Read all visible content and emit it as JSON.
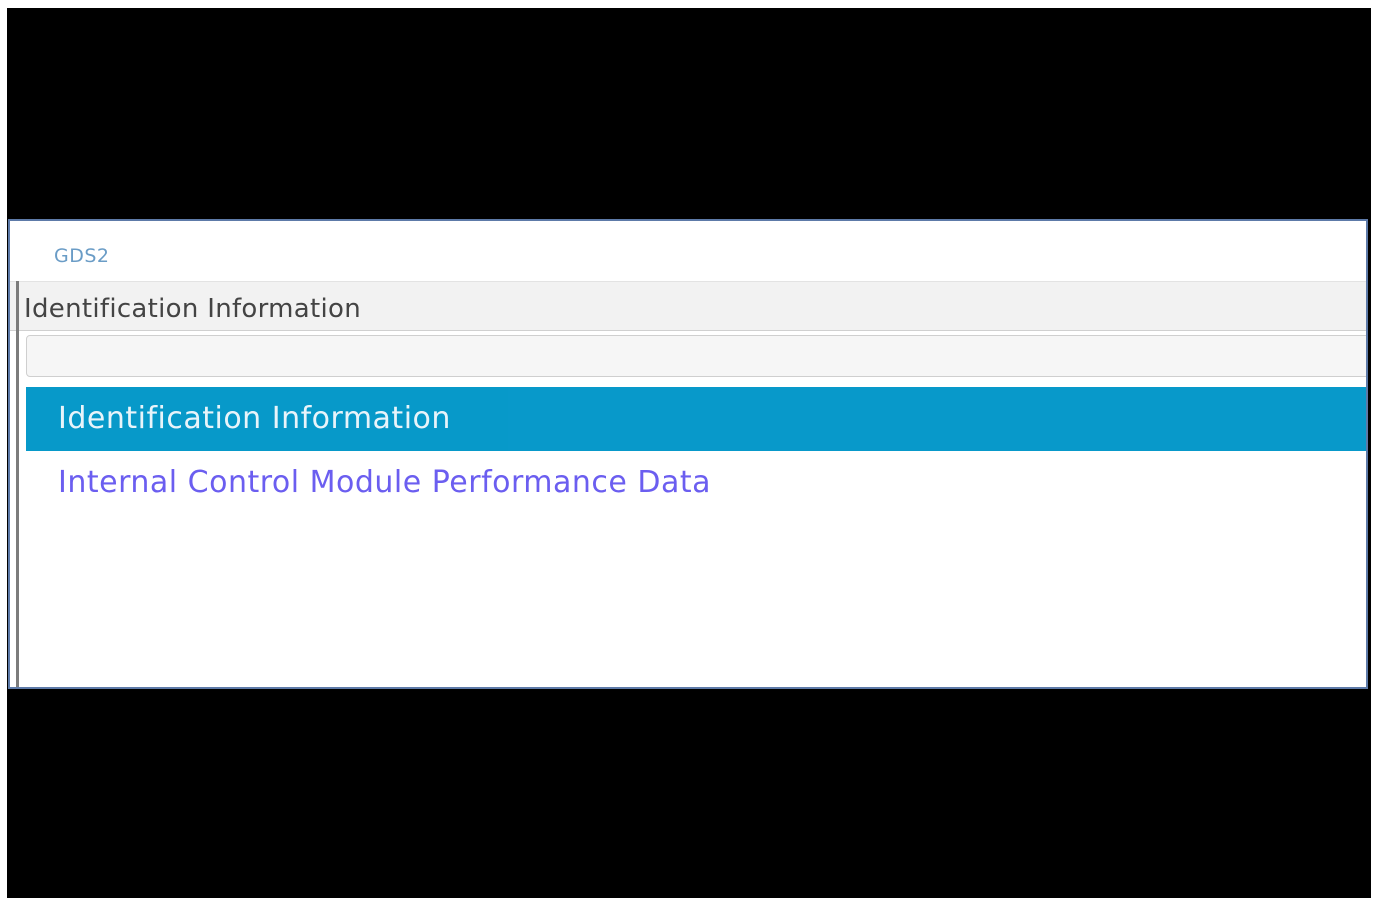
{
  "app": {
    "title": "GDS2"
  },
  "header": {
    "title": "Identification Information"
  },
  "filter": {
    "value": "",
    "placeholder": ""
  },
  "list": {
    "items": [
      {
        "label": "Identification Information",
        "selected": true
      },
      {
        "label": "Internal Control Module Performance Data",
        "selected": false
      }
    ]
  },
  "colors": {
    "selection": "#0096c8",
    "link_text": "#6b5ef0",
    "title_text": "#6a9cc6"
  }
}
